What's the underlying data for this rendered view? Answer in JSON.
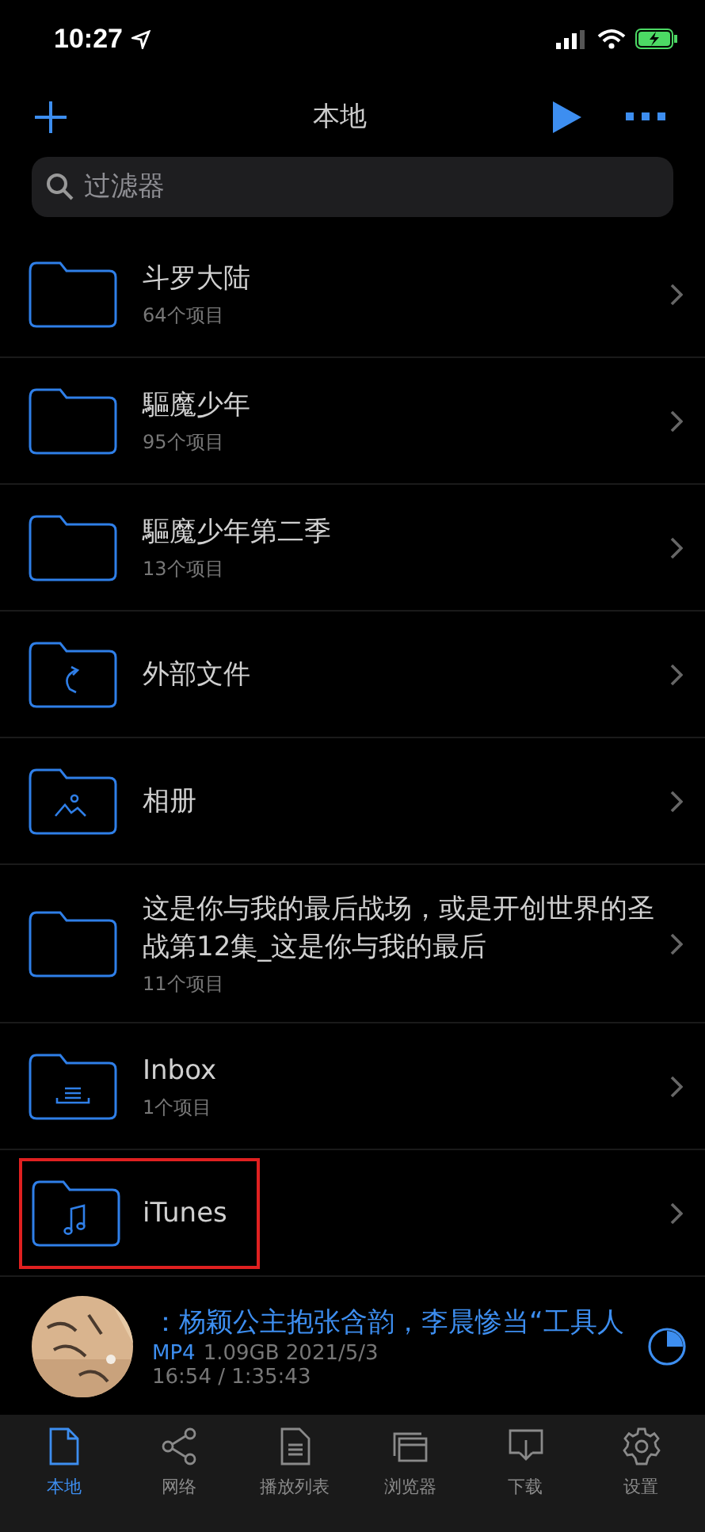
{
  "status_bar": {
    "time": "10:27"
  },
  "nav": {
    "title": "本地"
  },
  "search": {
    "placeholder": "过滤器"
  },
  "folders": [
    {
      "kind": "plain",
      "name": "斗罗大陆",
      "count": "64个项目",
      "highlighted": false
    },
    {
      "kind": "plain",
      "name": "驅魔少年",
      "count": "95个项目",
      "highlighted": false
    },
    {
      "kind": "plain",
      "name": "驅魔少年第二季",
      "count": "13个项目",
      "highlighted": false
    },
    {
      "kind": "external",
      "name": "外部文件",
      "highlighted": false
    },
    {
      "kind": "photos",
      "name": "相册",
      "highlighted": false
    },
    {
      "kind": "plain",
      "name": "这是你与我的最后战场，或是开创世界的圣战第12集_这是你与我的最后",
      "count": "11个项目",
      "highlighted": false
    },
    {
      "kind": "inbox",
      "name": "Inbox",
      "count": "1个项目",
      "highlighted": false
    },
    {
      "kind": "music",
      "name": "iTunes",
      "highlighted": true
    }
  ],
  "now_playing": {
    "title": "：杨颖公主抱张含韵，李晨惨当“工具人",
    "format": "MP4",
    "info": "1.09GB 2021/5/3",
    "position": "16:54 / 1:35:43"
  },
  "tabs": [
    {
      "kind": "local",
      "label": "本地",
      "selected": true
    },
    {
      "kind": "network",
      "label": "网络",
      "selected": false
    },
    {
      "kind": "playlist",
      "label": "播放列表",
      "selected": false
    },
    {
      "kind": "browser",
      "label": "浏览器",
      "selected": false
    },
    {
      "kind": "download",
      "label": "下载",
      "selected": false
    },
    {
      "kind": "settings",
      "label": "设置",
      "selected": false
    }
  ]
}
